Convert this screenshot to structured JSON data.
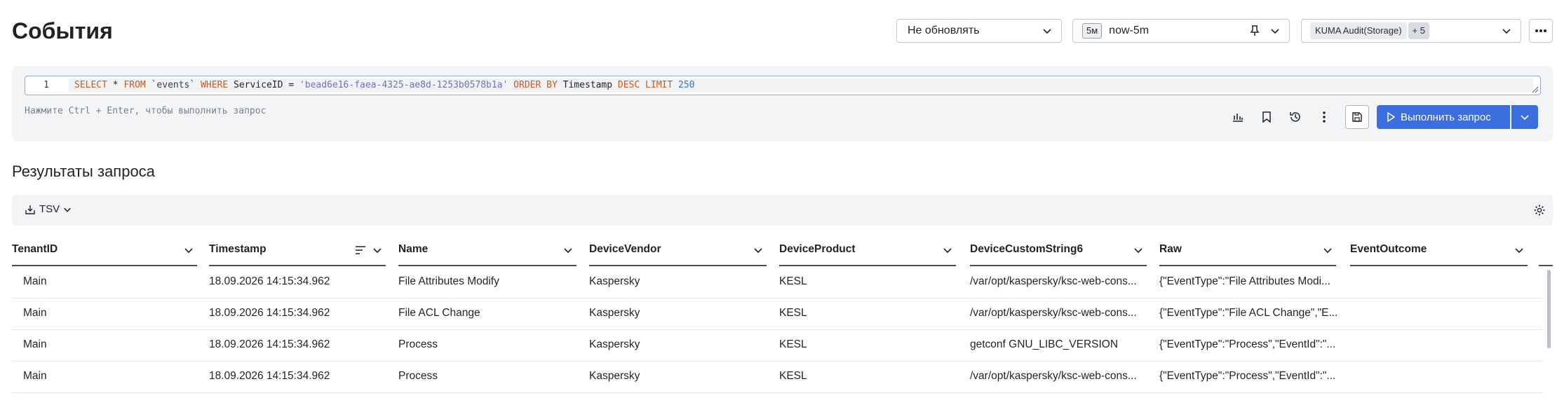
{
  "page": {
    "title": "События"
  },
  "header": {
    "refresh": {
      "value": "Не обновлять"
    },
    "time": {
      "badge": "5м",
      "value": "now-5m"
    },
    "storage": {
      "chip": "KUMA Audit(Storage)",
      "extra": "+ 5"
    }
  },
  "query": {
    "line_number": "1",
    "tokens": {
      "select": "SELECT",
      "star": " * ",
      "from": "FROM",
      "table": " `events` ",
      "where": "WHERE",
      "field": " ServiceID = ",
      "value": "'bead6e16-faea-4325-ae8d-1253b0578b1a'",
      "order": " ORDER BY",
      "ts": " Timestamp ",
      "desc": "DESC",
      "limit": " LIMIT",
      "limit_val": " 250"
    },
    "hint": "Нажмите Ctrl + Enter, чтобы выполнить запрос",
    "run_label": "Выполнить запрос"
  },
  "results": {
    "title": "Результаты запроса",
    "export_format": "TSV",
    "columns": [
      "TenantID",
      "Timestamp",
      "Name",
      "DeviceVendor",
      "DeviceProduct",
      "DeviceCustomString6",
      "Raw",
      "EventOutcome"
    ],
    "rows": [
      [
        "Main",
        "18.09.2026 14:15:34.962",
        "File Attributes Modify",
        "Kaspersky",
        "KESL",
        "/var/opt/kaspersky/ksc-web-cons...",
        "{\"EventType\":\"File Attributes Modi...",
        ""
      ],
      [
        "Main",
        "18.09.2026 14:15:34.962",
        "File ACL Change",
        "Kaspersky",
        "KESL",
        "/var/opt/kaspersky/ksc-web-cons...",
        "{\"EventType\":\"File ACL Change\",\"E...",
        ""
      ],
      [
        "Main",
        "18.09.2026 14:15:34.962",
        "Process",
        "Kaspersky",
        "KESL",
        "getconf GNU_LIBC_VERSION",
        "{\"EventType\":\"Process\",\"EventId\":\"...",
        ""
      ],
      [
        "Main",
        "18.09.2026 14:15:34.962",
        "Process",
        "Kaspersky",
        "KESL",
        "/var/opt/kaspersky/ksc-web-cons...",
        "{\"EventType\":\"Process\",\"EventId\":\"...",
        ""
      ]
    ]
  },
  "colors": {
    "accent": "#3b6fdf",
    "panel": "#f3f4f6"
  }
}
